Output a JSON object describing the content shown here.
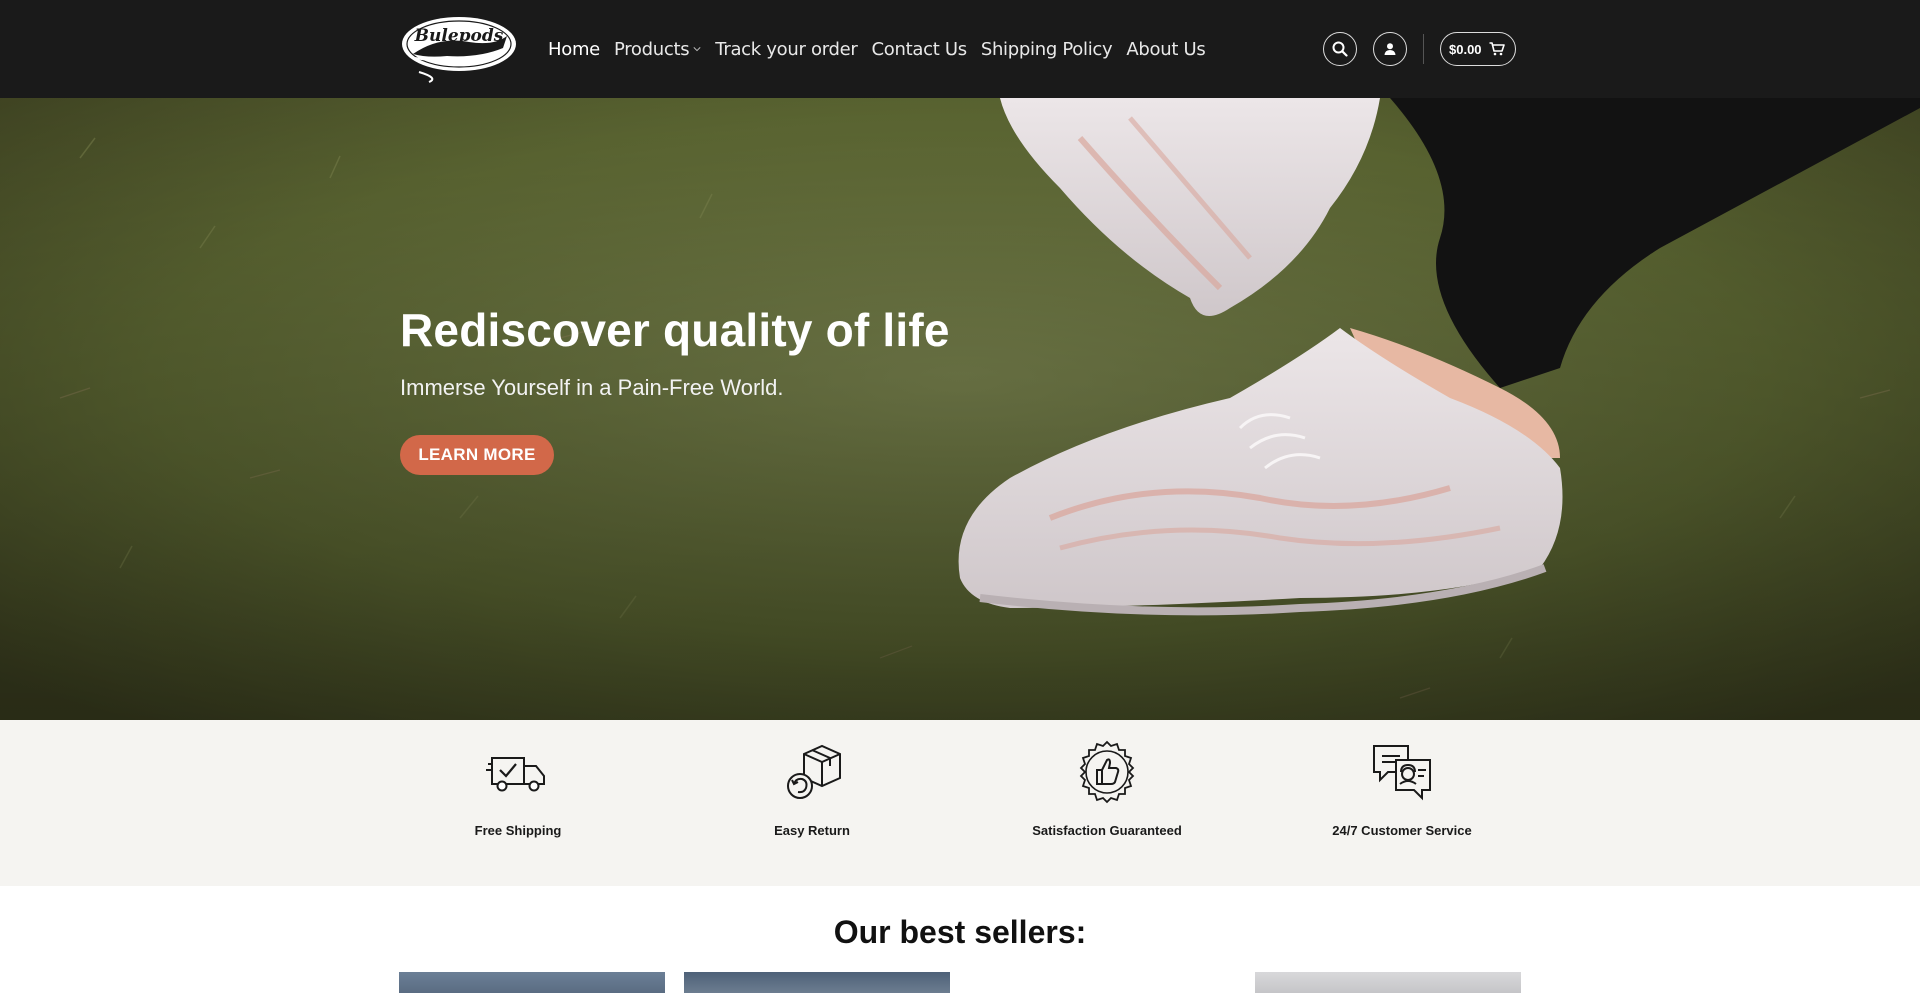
{
  "header": {
    "logo_text": "Bulepods",
    "nav": [
      {
        "label": "Home"
      },
      {
        "label": "Products"
      },
      {
        "label": "Track your order"
      },
      {
        "label": "Contact Us"
      },
      {
        "label": "Shipping Policy"
      },
      {
        "label": "About Us"
      }
    ],
    "cart_total": "$0.00",
    "icons": [
      "search-icon",
      "user-icon",
      "cart-icon"
    ]
  },
  "hero": {
    "title": "Rediscover quality of life",
    "subtitle": "Immerse Yourself in a Pain-Free World.",
    "button_label": "LEARN MORE"
  },
  "features": [
    {
      "label": "Free Shipping",
      "icon": "delivery-truck-icon"
    },
    {
      "label": "Easy Return",
      "icon": "return-box-icon"
    },
    {
      "label": "Satisfaction Guaranteed",
      "icon": "thumbs-up-badge-icon"
    },
    {
      "label": "24/7 Customer Service",
      "icon": "chat-support-icon"
    }
  ],
  "best_sellers": {
    "title": "Our best sellers:"
  },
  "colors": {
    "header_bg": "#1a1a1a",
    "accent": "#d26849",
    "features_bg": "#f5f4f1"
  }
}
